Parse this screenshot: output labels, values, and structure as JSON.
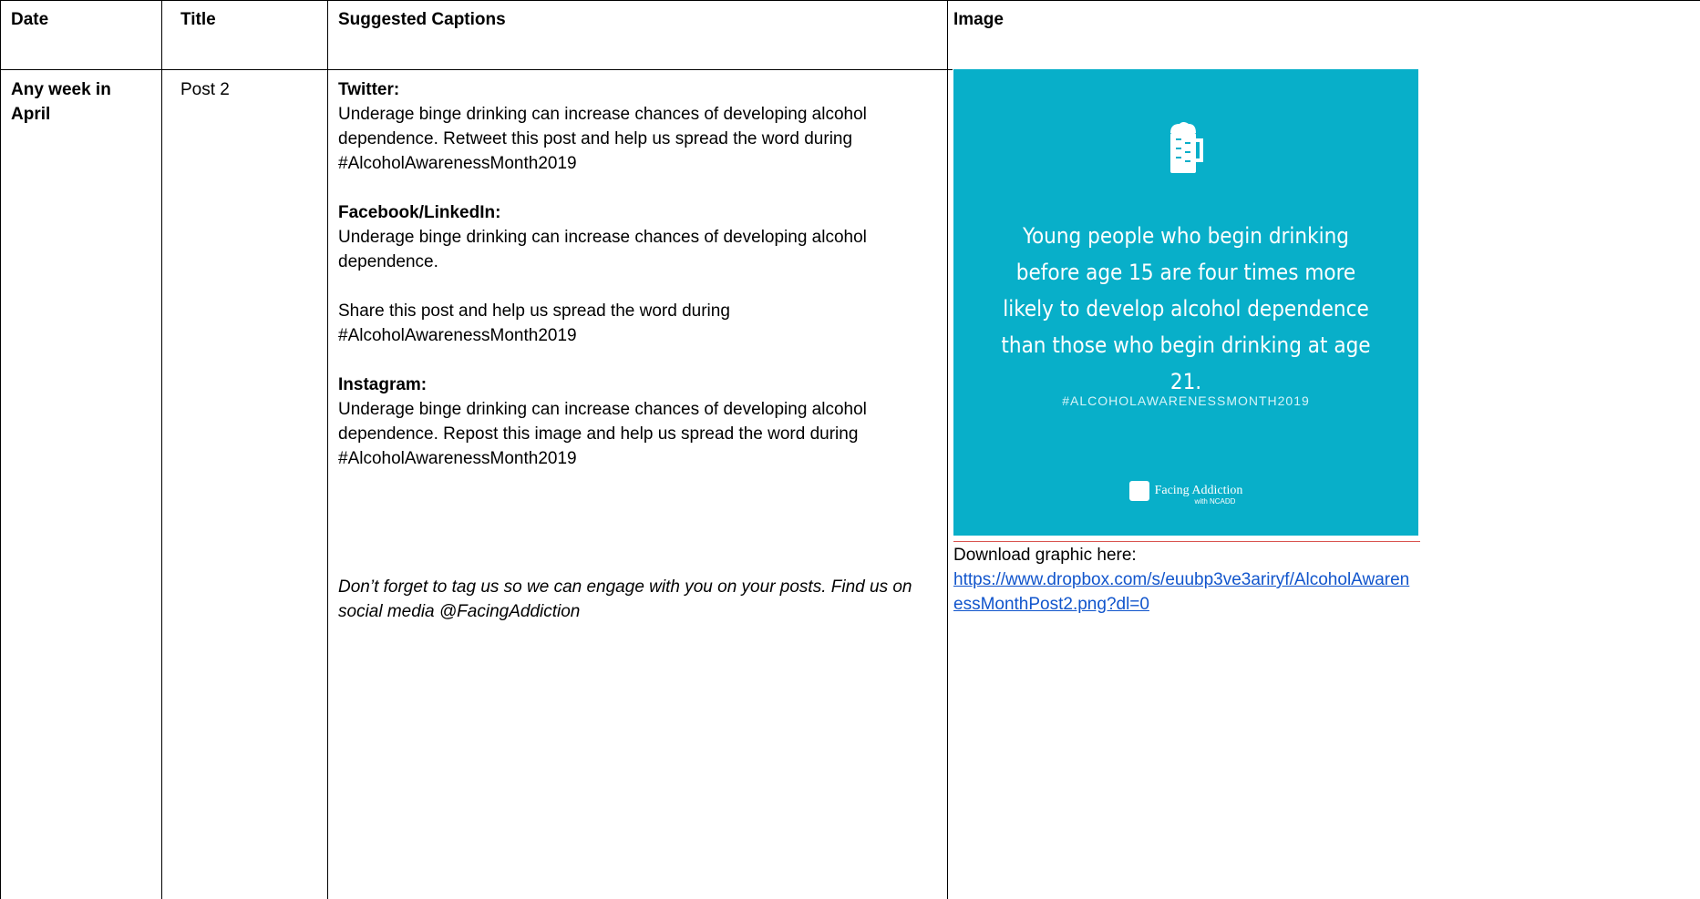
{
  "headers": {
    "date": "Date",
    "title": "Title",
    "captions": "Suggested Captions",
    "image": "Image"
  },
  "row": {
    "date": "Any week in April",
    "title": "Post 2",
    "twitter_label": "Twitter:",
    "twitter_text": "Underage binge drinking can increase chances of developing alcohol dependence. Retweet this post and help us spread the word during #AlcoholAwarenessMonth2019",
    "facebook_label": "Facebook/LinkedIn:",
    "facebook_text": "Underage binge drinking can increase chances of developing alcohol dependence.",
    "facebook_share": "Share this post and help us spread the word during #AlcoholAwarenessMonth2019",
    "instagram_label": "Instagram:",
    "instagram_text": "Underage binge drinking can increase chances of developing alcohol dependence. Repost this image and help us spread the word during #AlcoholAwarenessMonth2019",
    "reminder": "Don’t forget to tag us so we can engage with you on your posts. Find us on social media @FacingAddiction"
  },
  "graphic": {
    "icon": "beer-mug-icon",
    "statement": "Young people who begin drinking before age 15 are four times more likely to develop alcohol dependence than those who begin drinking at age 21.",
    "hashtag": "#ALCOHOLAWARENESSMONTH2019",
    "logo_text": "Facing Addiction",
    "logo_sub": "with NCADD",
    "background_color": "#08afc9"
  },
  "download": {
    "label": "Download graphic here:",
    "url": "https://www.dropbox.com/s/euubp3ve3ariryf/AlcoholAwarenessMonthPost2.png?dl=0"
  }
}
